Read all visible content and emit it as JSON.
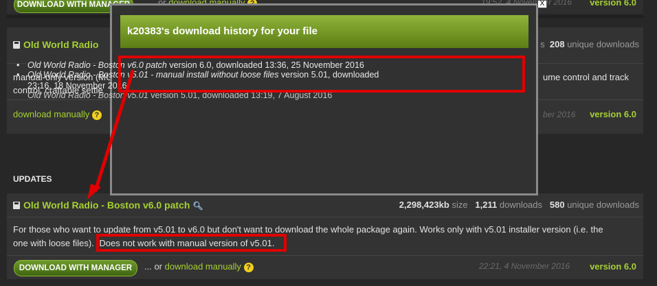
{
  "top_row": {
    "download_manager_label": "DOWNLOAD WITH MANAGER",
    "or_text": "or",
    "download_manually": "download manually",
    "help": "?",
    "date": "19:52, 4 November 2016",
    "version": "version 6.0"
  },
  "file1": {
    "title": "Old World Radio",
    "stats_unique_num": "208",
    "stats_unique_label": "unique downloads",
    "stats_fragment": "s",
    "desc_line1_left": "manual-only version (MU",
    "desc_line1_right": "ume control and track",
    "desc_line2": "control, craftable settle",
    "download_manually": "download manually",
    "help": "?",
    "date_fragment": "ber 2016",
    "version": "version 6.0"
  },
  "updates": {
    "heading": "UPDATES",
    "title": "Old World Radio - Boston v6.0 patch",
    "size_num": "2,298,423kb",
    "size_label": "size",
    "downloads_num": "1,211",
    "downloads_label": "downloads",
    "unique_num": "580",
    "unique_label": "unique downloads",
    "desc_line1": "For those who want to update from v5.01 to v6.0 but don't want to download the whole package again. Works only with v5.01 installer version (i.e. the",
    "desc_line2_start": "one with loose files).",
    "desc_line2_highlight": "Does not work with manual version of v5.01.",
    "download_manager_label": "DOWNLOAD WITH MANAGER",
    "ellipsis_or": "... or",
    "download_manually": "download manually",
    "help": "?",
    "date": "22:21, 4 November 2016",
    "version": "version 6.0"
  },
  "modal": {
    "title": "k20383's download history for your file",
    "close": "X",
    "history": [
      {
        "name": "Old World Radio - Boston v6.0 patch",
        "rest": " version 6.0, downloaded 13:36, 25 November 2016"
      },
      {
        "name": "Old World Radio - Boston v5.01 - manual install without loose files",
        "rest": " version 5.01, downloaded",
        "rest2": "23:16, 18 November 2016"
      },
      {
        "name": "Old World Radio - Boston v5.01",
        "rest": " version 5.01, downloaded 13:19, 7 August 2016"
      }
    ]
  },
  "colors": {
    "accent_green": "#a6d032",
    "highlight_red": "#e00000",
    "background": "#272727"
  }
}
